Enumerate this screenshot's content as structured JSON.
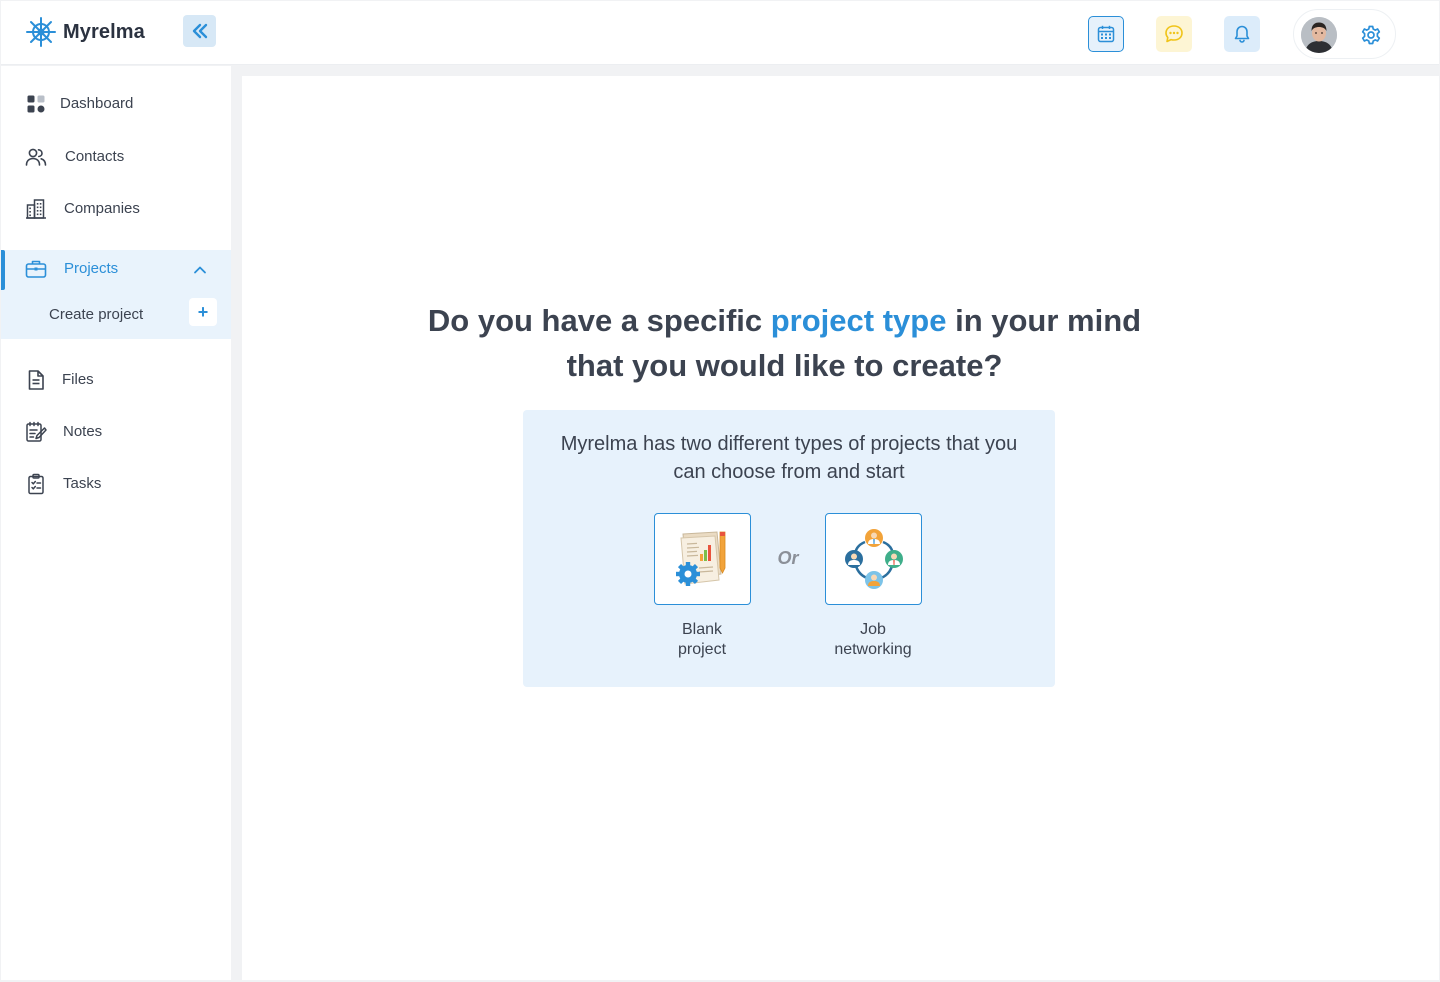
{
  "app": {
    "name": "Myrelma"
  },
  "colors": {
    "accent": "#2b8fd8",
    "text": "#3c4350",
    "panel": "#e7f2fc",
    "chat_bg": "#fdf5d4",
    "chat_icon": "#f0c419"
  },
  "header": {
    "icons": [
      "calendar-icon",
      "chat-icon",
      "bell-icon",
      "settings-icon"
    ]
  },
  "sidebar": {
    "items": [
      {
        "label": "Dashboard",
        "icon": "dashboard-icon"
      },
      {
        "label": "Contacts",
        "icon": "contacts-icon"
      },
      {
        "label": "Companies",
        "icon": "companies-icon"
      },
      {
        "label": "Projects",
        "icon": "briefcase-icon",
        "active": true,
        "expanded": true
      },
      {
        "label": "Files",
        "icon": "file-icon"
      },
      {
        "label": "Notes",
        "icon": "notes-icon"
      },
      {
        "label": "Tasks",
        "icon": "tasks-icon"
      }
    ],
    "sub_items": [
      {
        "label": "Create project",
        "action": "+"
      }
    ]
  },
  "main": {
    "headline_pre": "Do you have a specific ",
    "headline_highlight": "project type",
    "headline_post": " in your mind that you would like to create?",
    "description": "Myrelma has two different types of projects that you can choose from and start",
    "or_label": "Or",
    "options": [
      {
        "line1": "Blank",
        "line2": "project",
        "icon": "blank-project-icon"
      },
      {
        "line1": "Job",
        "line2": "networking",
        "icon": "job-networking-icon"
      }
    ]
  }
}
